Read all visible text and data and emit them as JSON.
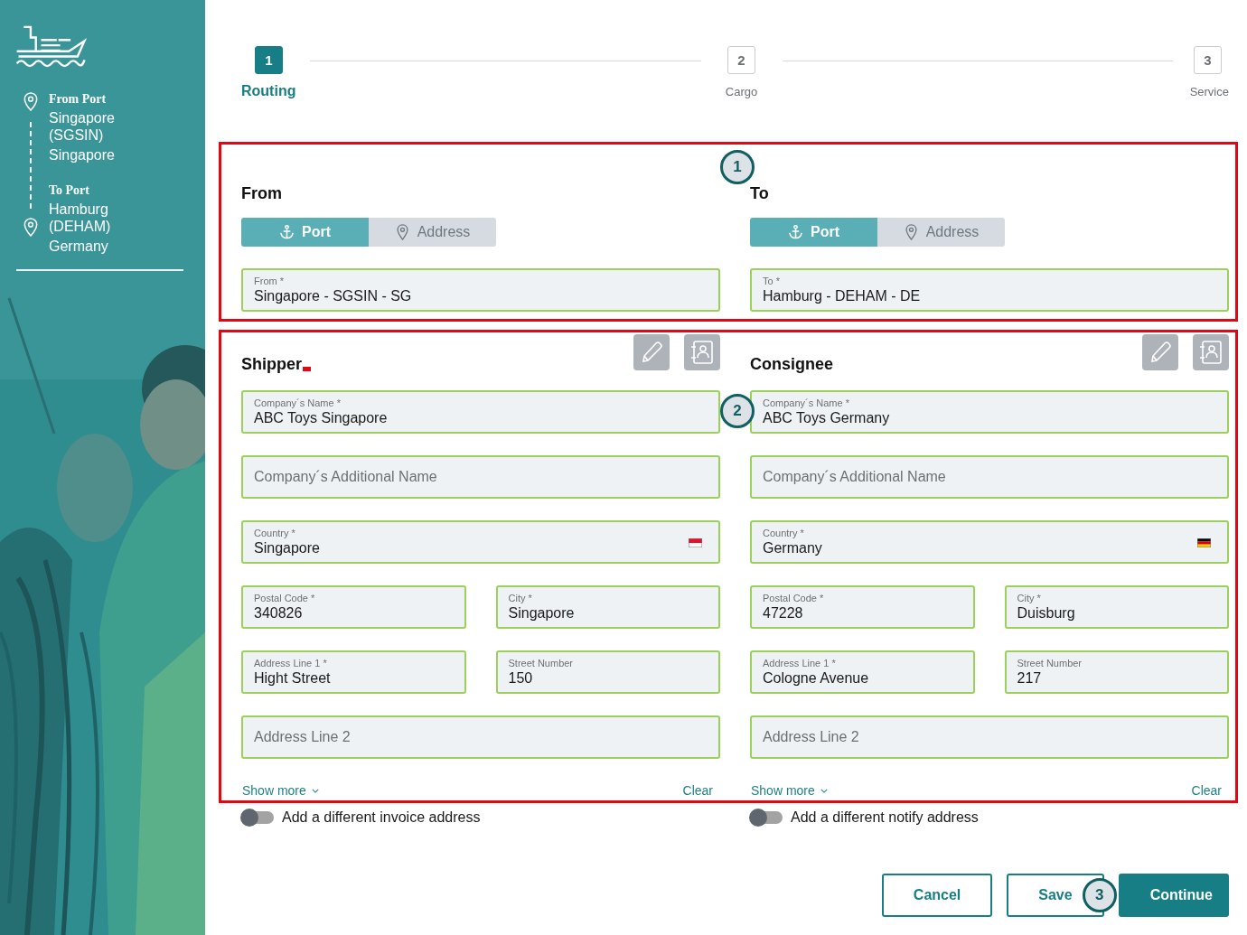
{
  "sidebar": {
    "route": [
      {
        "heading": "From Port",
        "place": "Singapore (SGSIN)",
        "country": "Singapore"
      },
      {
        "heading": "To Port",
        "place": "Hamburg (DEHAM)",
        "country": "Germany"
      }
    ]
  },
  "steps": [
    {
      "number": "1",
      "label": "Routing",
      "selected": true
    },
    {
      "number": "2",
      "label": "Cargo",
      "selected": false
    },
    {
      "number": "3",
      "label": "Service",
      "selected": false
    }
  ],
  "routing": {
    "annotation": "1",
    "columns": [
      {
        "title": "From",
        "modes": [
          {
            "label": "Port",
            "kind": "anchor",
            "selected": true
          },
          {
            "label": "Address",
            "kind": "pin",
            "selected": false
          }
        ],
        "field": {
          "label": "From *",
          "value": "Singapore - SGSIN - SG"
        }
      },
      {
        "title": "To",
        "modes": [
          {
            "label": "Port",
            "kind": "anchor",
            "selected": true
          },
          {
            "label": "Address",
            "kind": "pin",
            "selected": false
          }
        ],
        "field": {
          "label": "To *",
          "value": "Hamburg - DEHAM - DE"
        }
      }
    ]
  },
  "parties": {
    "annotation": "2",
    "columns": [
      {
        "title": "Shipper",
        "error_mark": true,
        "rows": [
          [
            {
              "label": "Company´s Name *",
              "value": "ABC Toys Singapore"
            }
          ],
          [
            {
              "placeholder": "Company´s Additional Name"
            }
          ],
          [
            {
              "label": "Country *",
              "value": "Singapore",
              "kind": "country"
            }
          ],
          [
            {
              "label": "Postal Code *",
              "value": "340826"
            },
            {
              "label": "City *",
              "value": "Singapore"
            }
          ],
          [
            {
              "label": "Address Line 1 *",
              "value": "Hight Street"
            },
            {
              "label": "Street Number",
              "value": "150"
            }
          ],
          [
            {
              "placeholder": "Address Line 2"
            }
          ]
        ],
        "show_more": "Show more",
        "clear": "Clear"
      },
      {
        "title": "Consignee",
        "error_mark": false,
        "rows": [
          [
            {
              "label": "Company´s Name *",
              "value": "ABC Toys Germany"
            }
          ],
          [
            {
              "placeholder": "Company´s Additional Name"
            }
          ],
          [
            {
              "label": "Country *",
              "value": "Germany",
              "kind": "country"
            }
          ],
          [
            {
              "label": "Postal Code *",
              "value": "47228"
            },
            {
              "label": "City *",
              "value": "Duisburg"
            }
          ],
          [
            {
              "label": "Address Line 1 *",
              "value": "Cologne Avenue"
            },
            {
              "label": "Street Number",
              "value": "217"
            }
          ],
          [
            {
              "placeholder": "Address Line 2"
            }
          ]
        ],
        "show_more": "Show more",
        "clear": "Clear"
      }
    ]
  },
  "toggles": [
    {
      "label": "Add a different invoice address",
      "on": false
    },
    {
      "label": "Add a different notify address",
      "on": false
    }
  ],
  "buttons": [
    {
      "label": "Cancel",
      "kind": "outline"
    },
    {
      "label": "Save",
      "kind": "outline"
    },
    {
      "label": "Continue",
      "kind": "primary",
      "annotation": "3"
    }
  ]
}
